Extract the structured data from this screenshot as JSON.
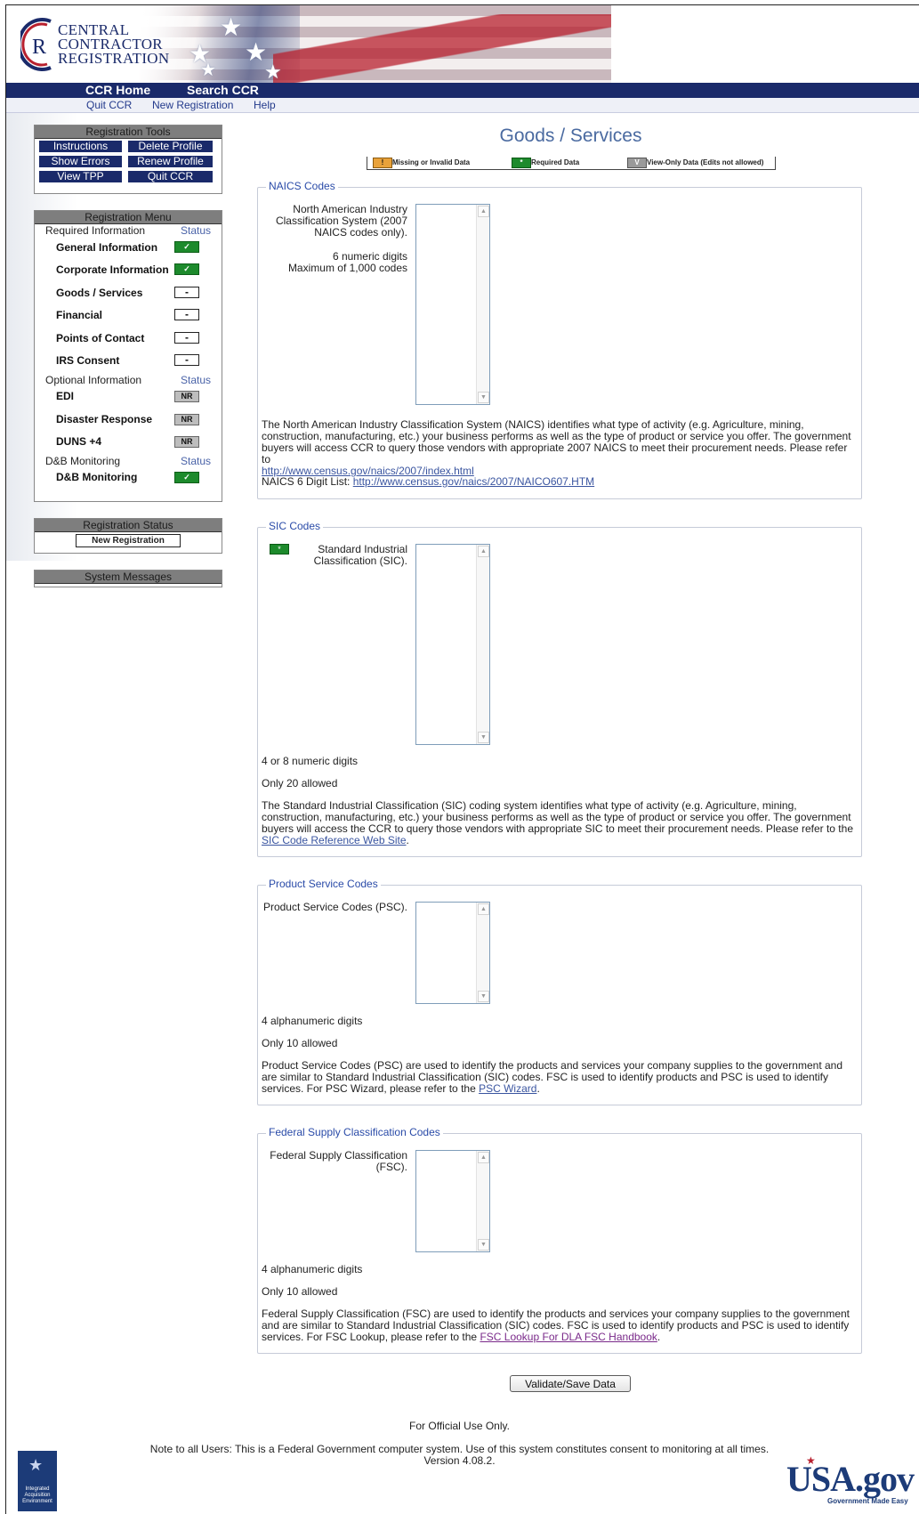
{
  "header": {
    "logo_line1": "CENTRAL",
    "logo_line2": "CONTRACTOR",
    "logo_line3": "REGISTRATION",
    "nav": [
      "CCR Home",
      "Search CCR"
    ],
    "subnav": [
      "Quit CCR",
      "New Registration",
      "Help"
    ]
  },
  "tools": {
    "title": "Registration Tools",
    "buttons": [
      "Instructions",
      "Delete Profile",
      "Show Errors",
      "Renew Profile",
      "View TPP",
      "Quit CCR"
    ]
  },
  "menu": {
    "title": "Registration Menu",
    "status_label": "Status",
    "categories": [
      "Required Information",
      "Optional Information",
      "D&B Monitoring"
    ],
    "required": [
      {
        "label": "General Information",
        "status": "ok"
      },
      {
        "label": "Corporate Information",
        "status": "ok"
      },
      {
        "label": "Goods / Services",
        "status": "-"
      },
      {
        "label": "Financial",
        "status": "-"
      },
      {
        "label": "Points of Contact",
        "status": "-"
      },
      {
        "label": "IRS Consent",
        "status": "-"
      }
    ],
    "optional": [
      {
        "label": "EDI",
        "status": "NR"
      },
      {
        "label": "Disaster Response",
        "status": "NR"
      },
      {
        "label": "DUNS +4",
        "status": "NR"
      }
    ],
    "monitoring": [
      {
        "label": "D&B Monitoring",
        "status": "ok"
      }
    ]
  },
  "reg_status": {
    "title": "Registration Status",
    "value": "New Registration"
  },
  "system_messages": {
    "title": "System Messages"
  },
  "page": {
    "title": "Goods / Services",
    "legend": [
      "Missing or Invalid Data",
      "Required Data",
      "View-Only Data (Edits not allowed)"
    ],
    "legend_icons": [
      "!",
      "*",
      "V"
    ]
  },
  "naics": {
    "title": "NAICS Codes",
    "label": "North American Industry Classification System (2007 NAICS codes only).",
    "hint1": "6 numeric digits",
    "hint2": "Maximum of 1,000 codes",
    "desc": "The North American Industry Classification System (NAICS) identifies what type of activity (e.g. Agriculture, mining, construction, manufacturing, etc.) your business performs as well as the type of product or service you offer. The government buyers will access CCR to query those vendors with appropriate 2007 NAICS to meet their procurement needs. Please refer to",
    "link1": "http://www.census.gov/naics/2007/index.html",
    "list_label": "NAICS 6 Digit List:",
    "link2": "http://www.census.gov/naics/2007/NAICO607.HTM"
  },
  "sic": {
    "title": "SIC Codes",
    "label": "Standard Industrial Classification (SIC).",
    "hint1": "4 or 8 numeric digits",
    "hint2": "Only 20 allowed",
    "desc": "The Standard Industrial Classification (SIC) coding system identifies what type of activity (e.g. Agriculture, mining, construction, manufacturing, etc.) your business performs as well as the type of product or service you offer. The government buyers will access the CCR to query those vendors with appropriate SIC to meet their procurement needs. Please refer to the",
    "link": "SIC Code Reference Web Site"
  },
  "psc": {
    "title": "Product Service Codes",
    "label": "Product Service Codes (PSC).",
    "hint1": "4 alphanumeric digits",
    "hint2": "Only 10 allowed",
    "desc": "Product Service Codes (PSC) are used to identify the products and services your company supplies to the government and are similar to Standard Industrial Classification (SIC) codes. FSC is used to identify products and PSC is used to identify services. For PSC Wizard, please refer to the",
    "link": "PSC Wizard"
  },
  "fsc": {
    "title": "Federal Supply Classification Codes",
    "label": "Federal Supply Classification (FSC).",
    "hint1": "4 alphanumeric digits",
    "hint2": "Only 10 allowed",
    "desc": "Federal Supply Classification (FSC) are used to identify the products and services your company supplies to the government and are similar to Standard Industrial Classification (SIC) codes. FSC is used to identify products and PSC is used to identify services. For FSC Lookup, please refer to the",
    "link": "FSC Lookup For DLA FSC Handbook"
  },
  "actions": {
    "save": "Validate/Save Data"
  },
  "footer": {
    "official": "For Official Use Only.",
    "note": "Note to all Users: This is a Federal Government computer system. Use of this system constitutes consent to monitoring at all times.",
    "version": "Version 4.08.2.",
    "iae_text": "Integrated Acquisition Environment",
    "usa_text": "USA.gov",
    "usa_tag": "Government Made Easy"
  },
  "colors": {
    "navy": "#1a2a6a",
    "ok_green": "#1d8a2c",
    "link_blue": "#3a55a0",
    "title_blue": "#4a6aa0"
  }
}
